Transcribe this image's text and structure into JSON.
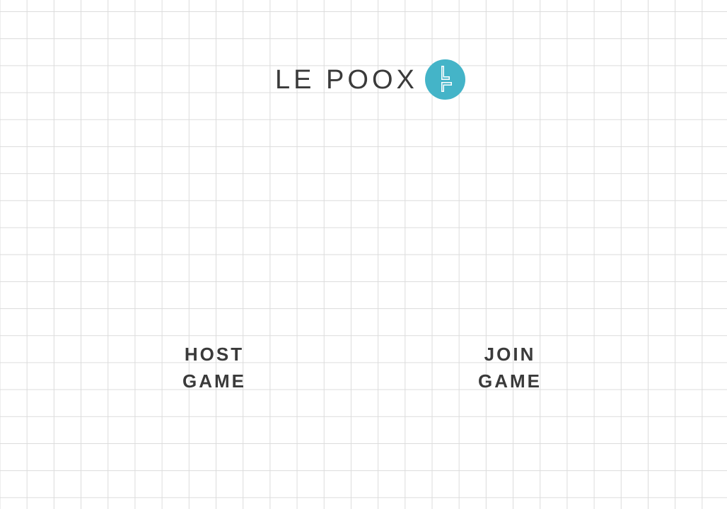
{
  "header": {
    "title": "LE POOX",
    "logo_icon": "poox-logo-icon"
  },
  "menu": {
    "host": {
      "line1": "HOST",
      "line2": "GAME"
    },
    "join": {
      "line1": "JOIN",
      "line2": "GAME"
    }
  },
  "colors": {
    "accent": "#44b4c8",
    "text": "#3a3a3a",
    "grid": "#dcdcdc",
    "background": "#ffffff"
  }
}
